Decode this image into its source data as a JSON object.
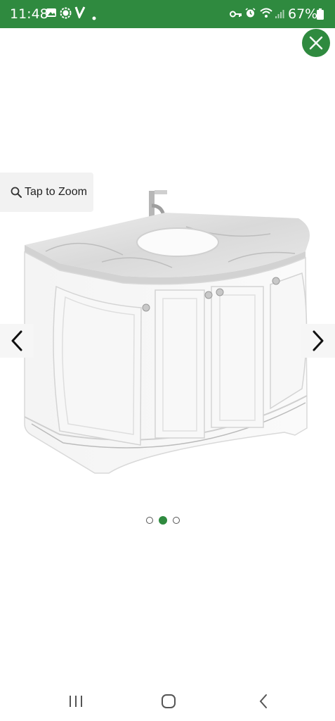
{
  "status_bar": {
    "time": "11:48",
    "battery": "67%",
    "icons": [
      "gallery-icon",
      "signal-app-icon",
      "v-app-icon",
      "dot-icon",
      "key-icon",
      "alarm-icon",
      "wifi-icon",
      "cell-signal-icon",
      "battery-icon"
    ]
  },
  "viewer": {
    "zoom_label": "Tap to Zoom",
    "close_icon": "close-icon",
    "prev_icon": "chevron-left-icon",
    "next_icon": "chevron-right-icon",
    "image_count": 3,
    "active_index": 1
  },
  "nav_bar": {
    "icons": [
      "recent-apps-icon",
      "home-icon",
      "back-icon"
    ]
  },
  "colors": {
    "accent": "#2f8a3f",
    "status_bar": "#2f8a3f"
  }
}
